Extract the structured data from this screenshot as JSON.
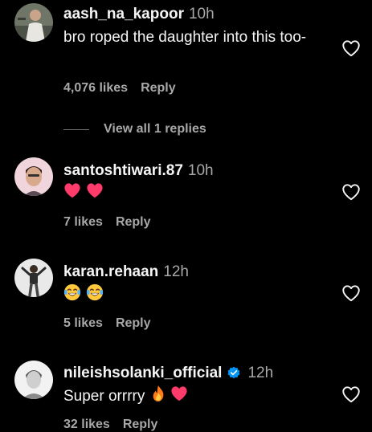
{
  "comments": [
    {
      "username": "aash_na_kapoor",
      "time": "10h",
      "text": "bro roped the daughter into this too-",
      "likes": "4,076 likes",
      "reply": "Reply",
      "view_replies": "View all 1 replies"
    },
    {
      "username": "santoshtiwari.87",
      "time": "10h",
      "text": "",
      "emojis": [
        "red-heart",
        "red-heart"
      ],
      "likes": "7 likes",
      "reply": "Reply"
    },
    {
      "username": "karan.rehaan",
      "time": "12h",
      "text": "",
      "emojis": [
        "tears-of-joy",
        "tears-of-joy"
      ],
      "likes": "5 likes",
      "reply": "Reply"
    },
    {
      "username": "nileishsolanki_official",
      "time": "12h",
      "verified": true,
      "text": "Super orrrry",
      "emojis": [
        "fire",
        "red-heart"
      ],
      "likes": "32 likes",
      "reply": "Reply"
    }
  ],
  "icons": {
    "like": "heart-outline-icon",
    "verified": "verified-badge-icon"
  },
  "colors": {
    "background": "#000000",
    "primary_text": "#f5f5f5",
    "secondary_text": "#a8a8a8",
    "verified_blue": "#0095f6",
    "heart_red": "#ff3b6b"
  }
}
